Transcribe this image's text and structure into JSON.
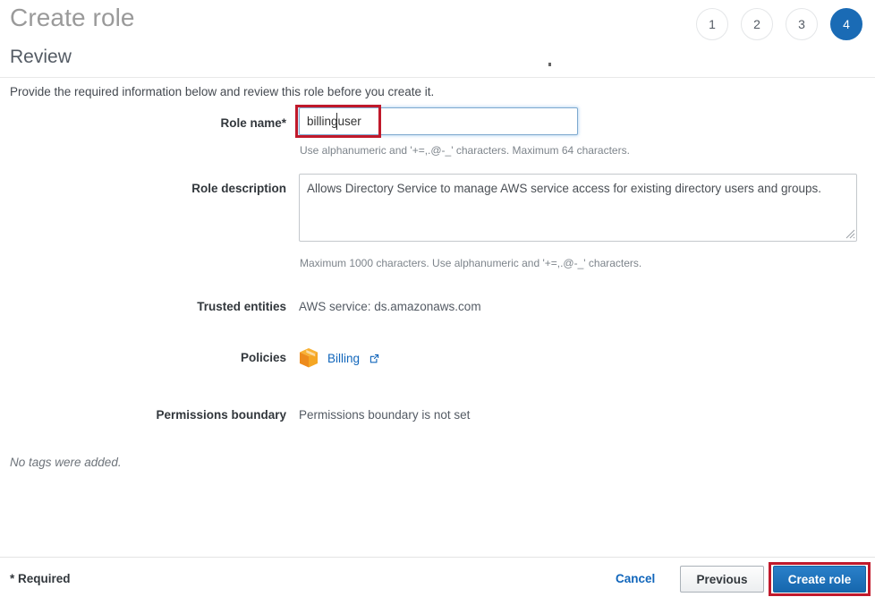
{
  "header": {
    "title": "Create role",
    "steps": [
      {
        "label": "1",
        "active": false
      },
      {
        "label": "2",
        "active": false
      },
      {
        "label": "3",
        "active": false
      },
      {
        "label": "4",
        "active": true
      }
    ]
  },
  "section": {
    "title": "Review",
    "intro": "Provide the required information below and review this role before you create it."
  },
  "form": {
    "role_name": {
      "label": "Role name*",
      "value": "billinguser",
      "placeholder": "",
      "hint": "Use alphanumeric and '+=,.@-_' characters. Maximum 64 characters."
    },
    "role_description": {
      "label": "Role description",
      "value": "Allows Directory Service to manage AWS service access for existing directory users and groups.",
      "placeholder": "",
      "hint": "Maximum 1000 characters. Use alphanumeric and '+=,.@-_' characters."
    },
    "trusted_entities": {
      "label": "Trusted entities",
      "value": "AWS service: ds.amazonaws.com"
    },
    "policies": {
      "label": "Policies",
      "icon": "policy-cube-icon",
      "link_text": "Billing",
      "link_icon": "external-link-icon"
    },
    "permissions_boundary": {
      "label": "Permissions boundary",
      "value": "Permissions boundary is not set"
    },
    "tags_note": "No tags were added."
  },
  "footer": {
    "required_note": "* Required",
    "cancel_label": "Cancel",
    "previous_label": "Previous",
    "create_label": "Create role"
  },
  "colors": {
    "accent_blue": "#1a6bb5",
    "link_blue": "#1166bb",
    "annotation_red": "#c0192b",
    "policy_orange": "#f0931f",
    "muted_text": "#545b64"
  }
}
